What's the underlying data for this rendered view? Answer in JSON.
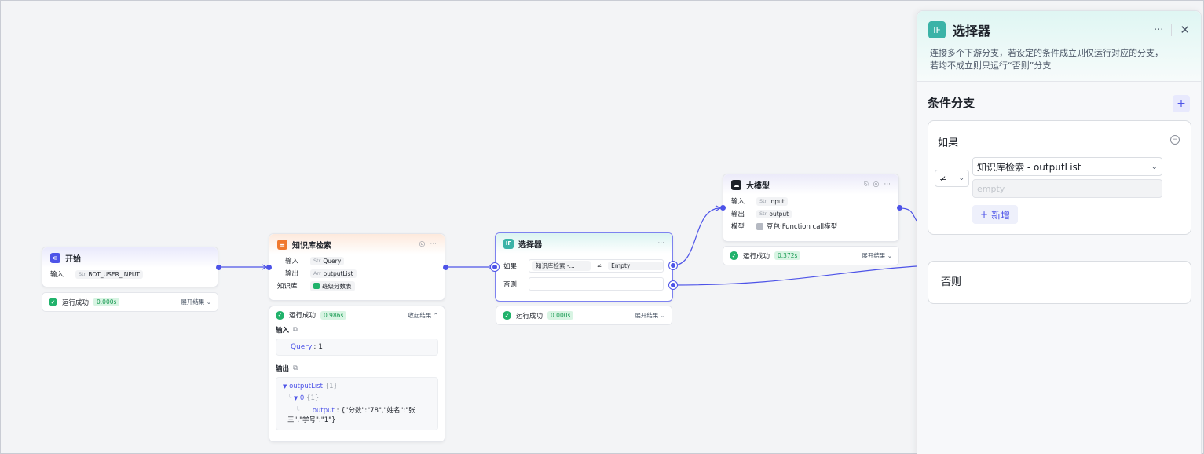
{
  "colors": {
    "accent": "#4d53e8",
    "success": "#20b26b",
    "start_icon": "#4d53e8",
    "kb_icon": "#f0782d",
    "if_icon": "#3bb3a7",
    "llm_icon": "#1d2129"
  },
  "start_node": {
    "title": "开始",
    "input_label": "输入",
    "input_type": "Str",
    "input_value": "BOT_USER_INPUT",
    "status": "运行成功",
    "time": "0.000s",
    "expand": "展开结果 ⌄"
  },
  "kb_node": {
    "title": "知识库检索",
    "input_label": "输入",
    "input_type": "Str",
    "input_value": "Query",
    "output_label": "输出",
    "output_type": "Arr",
    "output_value": "outputList",
    "kb_label": "知识库",
    "kb_value": "班级分数表",
    "status": "运行成功",
    "time": "0.986s",
    "collapse": "收起结果 ⌃",
    "result_input_title": "输入",
    "result_input_key": "Query",
    "result_input_val": ": 1",
    "result_output_title": "输出",
    "tree_root": "outputList",
    "tree_root_count": "{1}",
    "tree_child": "0",
    "tree_child_count": "{1}",
    "tree_leaf_key": "output",
    "tree_leaf_val_1": ": {\"分数\":\"78\",\"姓名\":\"张",
    "tree_leaf_val_2": "三\",\"学号\":\"1\"}"
  },
  "if_node": {
    "title": "选择器",
    "if_label": "如果",
    "cond_var": "知识库检索 -...",
    "cond_op": "≠",
    "cond_value": "Empty",
    "else_label": "否则",
    "status": "运行成功",
    "time": "0.000s",
    "expand": "展开结果 ⌄"
  },
  "llm_node": {
    "title": "大模型",
    "input_label": "输入",
    "input_type": "Str",
    "input_value": "input",
    "output_label": "输出",
    "output_type": "Str",
    "output_value": "output",
    "model_label": "模型",
    "model_value": "豆包·Function call模型",
    "status": "运行成功",
    "time": "0.372s",
    "expand": "展开结果 ⌄"
  },
  "panel": {
    "title": "选择器",
    "icon_text": "IF",
    "desc_line1": "连接多个下游分支，若设定的条件成立则仅运行对应的分支，",
    "desc_line2": "若均不成立则只运行“否则”分支",
    "section_title": "条件分支",
    "if_card_label": "如果",
    "op_symbol": "≠",
    "var_value": "知识库检索 - outputList",
    "value_placeholder": "empty",
    "new_btn": "新增",
    "else_card_label": "否则"
  }
}
